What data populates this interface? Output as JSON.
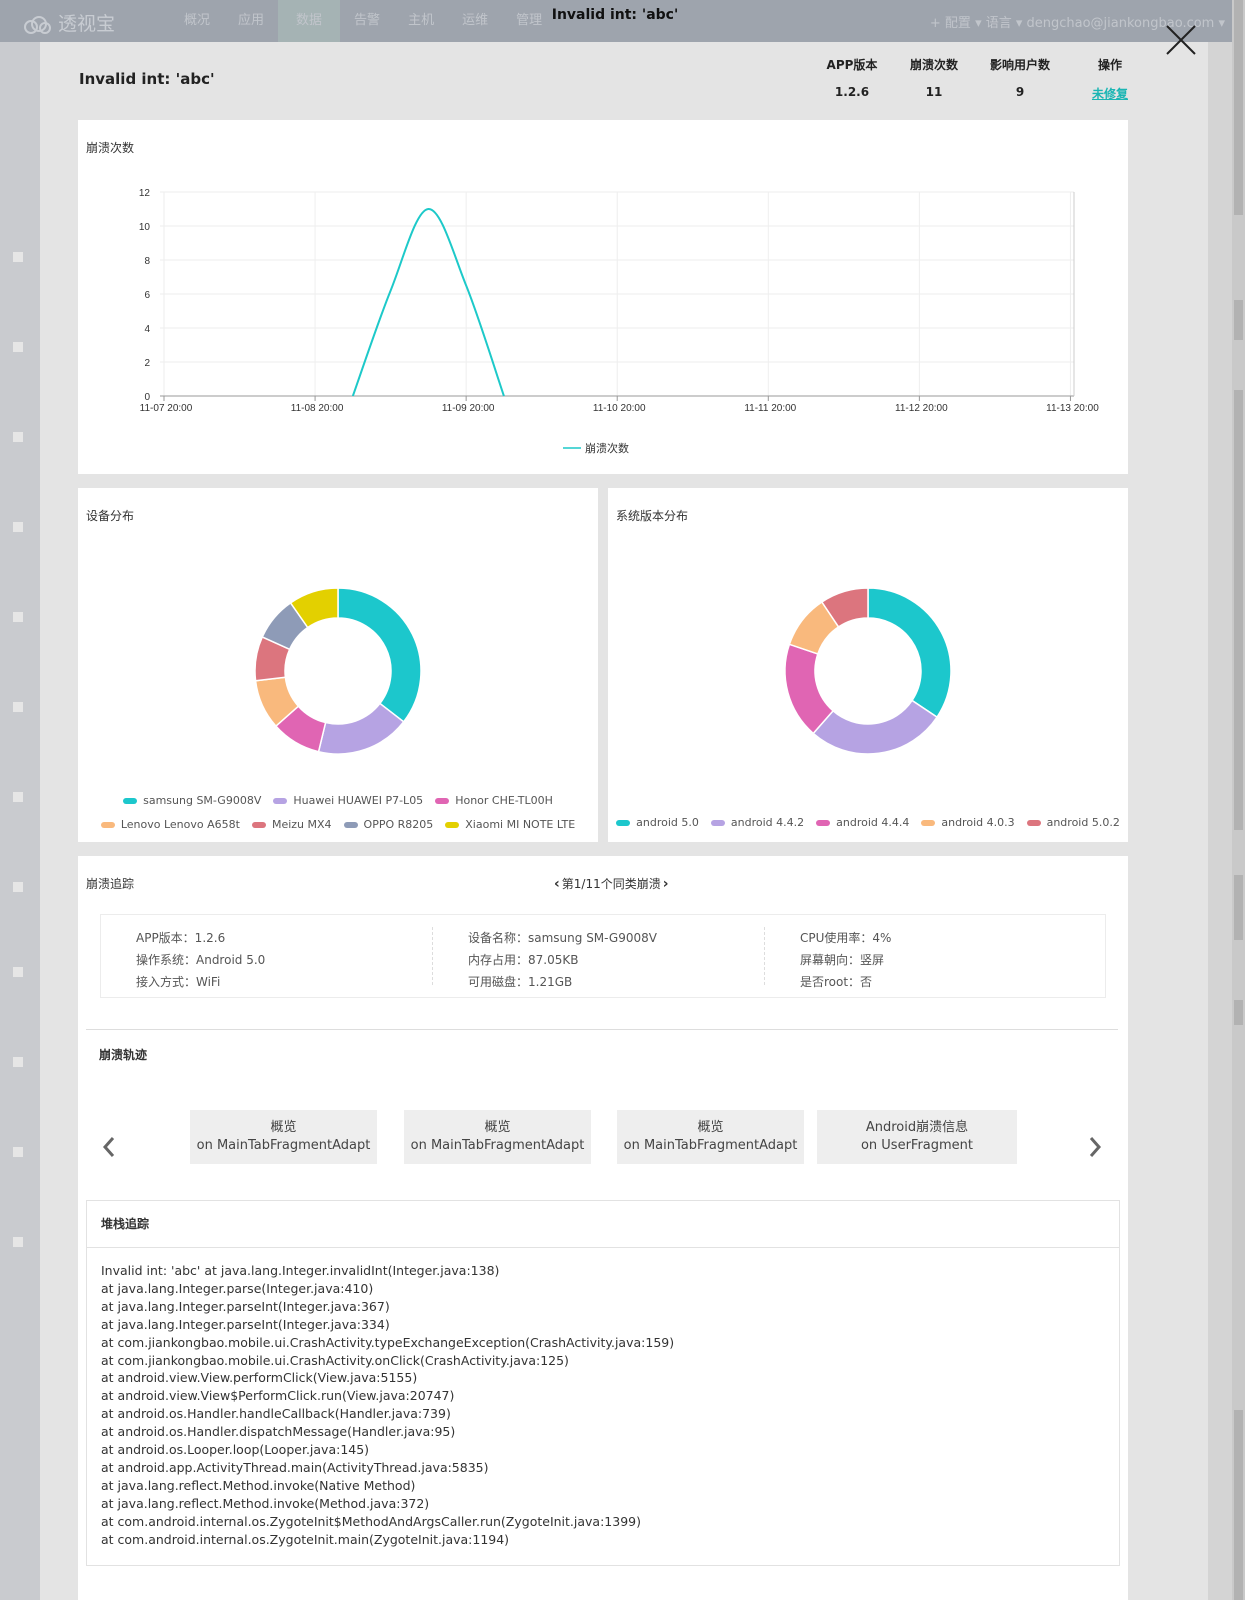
{
  "background": {
    "logo": "透视宝",
    "nav": [
      "概况",
      "应用",
      "数据",
      "告警",
      "主机",
      "运维",
      "管理"
    ],
    "nav_active_index": 2,
    "right_items": [
      "+ 配置 ▾",
      "语言 ▾",
      "dengchao@jiankongbao.com ▾"
    ]
  },
  "window_title": "Invalid int: 'abc'",
  "modal": {
    "title": "Invalid int: 'abc'",
    "summary": {
      "app_version_label": "APP版本",
      "app_version": "1.2.6",
      "crash_count_label": "崩溃次数",
      "crash_count": "11",
      "affected_users_label": "影响用户数",
      "affected_users": "9",
      "action_label": "操作",
      "action_link": "未修复"
    }
  },
  "colors": {
    "accent": "#1ab5b3",
    "line": "#1dc9c9",
    "slices": [
      "#1cc7cc",
      "#b6a3e3",
      "#e065b3",
      "#f9b97d",
      "#dc757e",
      "#8e9bb7",
      "#e3d000"
    ]
  },
  "crash_chart_title": "崩溃次数",
  "device_title": "设备分布",
  "os_title": "系统版本分布",
  "chart_data": [
    {
      "type": "line",
      "title": "崩溃次数",
      "x": [
        "11-07 20:00",
        "11-08 20:00",
        "11-09 20:00",
        "11-10 20:00",
        "11-11 20:00",
        "11-12 20:00",
        "11-13 20:00"
      ],
      "series": [
        {
          "name": "崩溃次数",
          "points": [
            [
              1.25,
              0
            ],
            [
              1.5,
              6.2
            ],
            [
              1.75,
              11
            ],
            [
              2.0,
              6.5
            ],
            [
              2.25,
              0
            ]
          ]
        }
      ],
      "ylim": [
        0,
        12
      ],
      "yticks": [
        "0",
        "2",
        "4",
        "6",
        "8",
        "10",
        "12"
      ],
      "grid": true,
      "legend": "bottom"
    },
    {
      "type": "pie",
      "title": "设备分布",
      "donut": true,
      "labels": [
        "samsung SM-G9008V",
        "Huawei HUAWEI P7-L05",
        "Honor CHE-TL00H",
        "Lenovo Lenovo A658t",
        "Meizu MX4",
        "OPPO R8205",
        "Xiaomi MI NOTE LTE"
      ],
      "values": [
        33,
        17,
        9,
        9,
        8,
        8,
        9
      ],
      "legend": "bottom"
    },
    {
      "type": "pie",
      "title": "系统版本分布",
      "donut": true,
      "labels": [
        "android 5.0",
        "android 4.4.2",
        "android 4.4.4",
        "android 4.0.3",
        "android 5.0.2"
      ],
      "values": [
        33,
        26,
        18,
        10,
        9
      ],
      "legend": "bottom"
    }
  ],
  "trace": {
    "title": "崩溃追踪",
    "pager": "第1/11个同类崩溃",
    "info": [
      [
        "APP版本：1.2.6",
        "操作系统：Android 5.0",
        "接入方式：WiFi"
      ],
      [
        "设备名称：samsung SM-G9008V",
        "内存占用：87.05KB",
        "可用磁盘：1.21GB"
      ],
      [
        "CPU使用率：4%",
        "屏幕朝向：竖屏",
        "是否root：否"
      ]
    ],
    "trail_title": "崩溃轨迹",
    "trail_cards": [
      {
        "line1": "概览",
        "line2": "on MainTabFragmentAdapt"
      },
      {
        "line1": "概览",
        "line2": "on MainTabFragmentAdapt"
      },
      {
        "line1": "概览",
        "line2": "on MainTabFragmentAdapt"
      },
      {
        "line1": "Android崩溃信息",
        "line2": "on UserFragment"
      }
    ],
    "stack_title": "堆栈追踪",
    "stack": [
      "Invalid int: 'abc' at java.lang.Integer.invalidInt(Integer.java:138)",
      "at java.lang.Integer.parse(Integer.java:410)",
      "at java.lang.Integer.parseInt(Integer.java:367)",
      "at java.lang.Integer.parseInt(Integer.java:334)",
      "at com.jiankongbao.mobile.ui.CrashActivity.typeExchangeException(CrashActivity.java:159)",
      "at com.jiankongbao.mobile.ui.CrashActivity.onClick(CrashActivity.java:125)",
      "at android.view.View.performClick(View.java:5155)",
      "at android.view.View$PerformClick.run(View.java:20747)",
      "at android.os.Handler.handleCallback(Handler.java:739)",
      "at android.os.Handler.dispatchMessage(Handler.java:95)",
      "at android.os.Looper.loop(Looper.java:145)",
      "at android.app.ActivityThread.main(ActivityThread.java:5835)",
      "at java.lang.reflect.Method.invoke(Native Method)",
      "at java.lang.reflect.Method.invoke(Method.java:372)",
      "at com.android.internal.os.ZygoteInit$MethodAndArgsCaller.run(ZygoteInit.java:1399)",
      "at com.android.internal.os.ZygoteInit.main(ZygoteInit.java:1194)"
    ]
  }
}
